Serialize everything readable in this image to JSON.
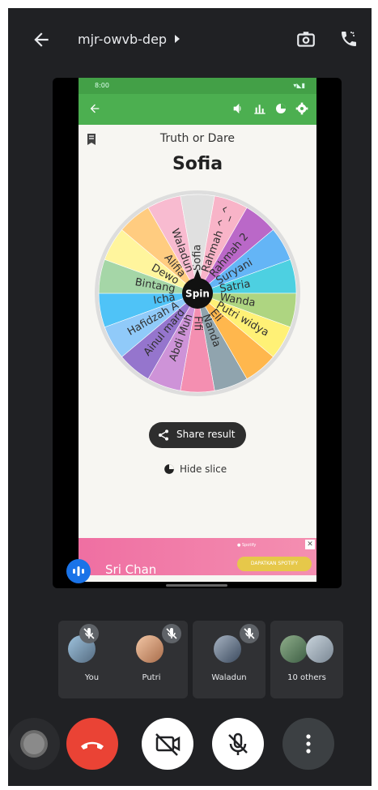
{
  "topbar": {
    "meeting_code": "mjr-owvb-dep",
    "back_icon": "back-arrow-icon",
    "flip_camera_icon": "flip-camera-icon",
    "call_icon": "phone-call-icon"
  },
  "phone_screen": {
    "status_time": "8:00",
    "toolbar_icons": [
      "back-arrow-icon",
      "volume-icon",
      "bar-chart-icon",
      "pie-chart-icon",
      "settings-icon"
    ],
    "title": "Truth or Dare",
    "winner": "Sofia",
    "wheel": {
      "center_label": "Spin",
      "slices": [
        {
          "name": "Sofia",
          "color": "#e0e0e0"
        },
        {
          "name": "Rahmah ^_^",
          "color": "#f8b4c8"
        },
        {
          "name": "Rahmah 2",
          "color": "#ba68c8"
        },
        {
          "name": "Suryani",
          "color": "#64b5f6"
        },
        {
          "name": "Satria",
          "color": "#4dd0e1"
        },
        {
          "name": "Wanda",
          "color": "#aed581"
        },
        {
          "name": "Putri widya",
          "color": "#fff176"
        },
        {
          "name": "Eli",
          "color": "#ffb74d"
        },
        {
          "name": "Nanda",
          "color": "#90a4ae"
        },
        {
          "name": "Fifi",
          "color": "#f48fb1"
        },
        {
          "name": "Abdi Muh",
          "color": "#ce93d8"
        },
        {
          "name": "Ainul mard",
          "color": "#9575cd"
        },
        {
          "name": "Hafidzah A",
          "color": "#90caf9"
        },
        {
          "name": "Icha",
          "color": "#4fc3f7"
        },
        {
          "name": "Bintang",
          "color": "#a5d6a7"
        },
        {
          "name": "Dewo",
          "color": "#fff59d"
        },
        {
          "name": "Alifia",
          "color": "#ffcc80"
        },
        {
          "name": "Waladun",
          "color": "#f8bbd0"
        }
      ]
    },
    "share_label": "Share result",
    "hide_slice_label": "Hide slice",
    "ad_button": "DAPATKAN SPOTIFY"
  },
  "speaker": {
    "name": "Sri Chan"
  },
  "participants": [
    {
      "name": "You",
      "muted": true
    },
    {
      "name": "Putri",
      "muted": true
    },
    {
      "name": "Waladun",
      "muted": true
    },
    {
      "name": "10 others"
    }
  ],
  "controls": {
    "icons": [
      "audio-device-icon",
      "end-call-icon",
      "camera-off-icon",
      "mic-off-icon",
      "more-options-icon"
    ],
    "colors": {
      "end_call": "#ea4335",
      "surface": "#3c4043",
      "background": "#202124"
    }
  }
}
